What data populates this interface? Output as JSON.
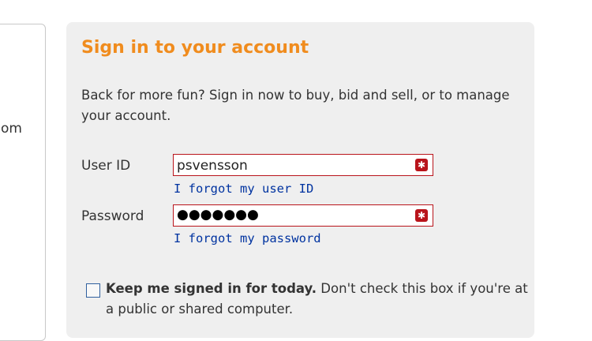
{
  "left_panel": {
    "fragment_text": "om"
  },
  "signin": {
    "title": "Sign in to your account",
    "intro": "Back for more fun? Sign in now to buy, bid and sell, or to manage your account.",
    "user_id": {
      "label": "User ID",
      "value": "psvensson",
      "forgot_link": "I forgot my user ID",
      "error_icon": "error-x-icon"
    },
    "password": {
      "label": "Password",
      "masked_value": "●●●●●●●",
      "forgot_link": "I forgot my password",
      "error_icon": "error-x-icon"
    },
    "keep_signed_in": {
      "checked": false,
      "bold_label": "Keep me signed in for today.",
      "note": " Don't check this box if you're at a public or shared computer."
    }
  },
  "colors": {
    "title": "#f08c1e",
    "error": "#b9141b",
    "link": "#0033a0",
    "card_bg": "#efefef"
  }
}
